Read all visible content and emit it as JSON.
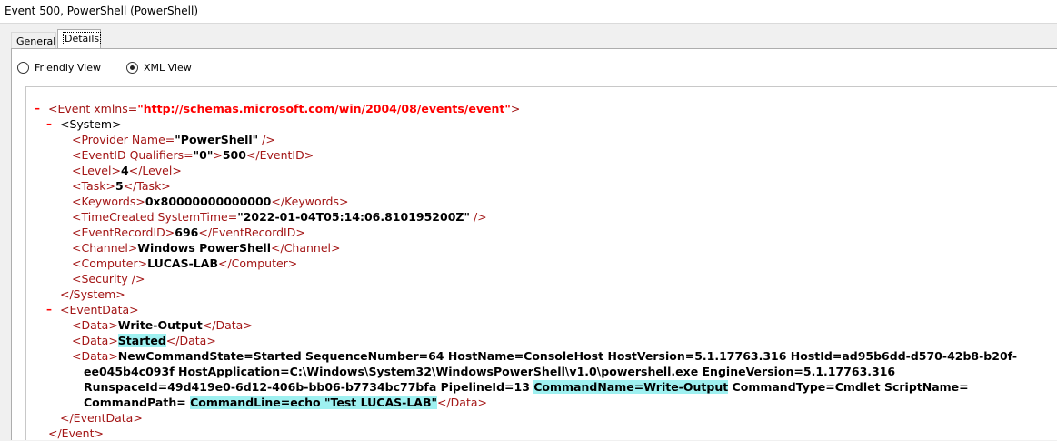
{
  "window": {
    "title": "Event 500, PowerShell (PowerShell)"
  },
  "tabs": [
    {
      "label": "General"
    },
    {
      "label": "Details"
    }
  ],
  "view_options": {
    "friendly": "Friendly View",
    "xml": "XML View",
    "selected": "XML View"
  },
  "xml": {
    "event_open": "<Event xmlns=",
    "xmlns_value": "\"http://schemas.microsoft.com/win/2004/08/events/event\"",
    "event_open_end": ">",
    "system_open": "<System>",
    "provider_tag": "<Provider Name=",
    "provider_value": "\"PowerShell\"",
    "provider_end": " />",
    "eventid_tag": "<EventID Qualifiers=",
    "eventid_qual": "\"0\"",
    "eventid_gt": ">",
    "eventid_value": "500",
    "eventid_close": "</EventID>",
    "level_tag": "<Level>",
    "level_value": "4",
    "level_close": "</Level>",
    "task_tag": "<Task>",
    "task_value": "5",
    "task_close": "</Task>",
    "keywords_tag": "<Keywords>",
    "keywords_value": "0x80000000000000",
    "keywords_close": "</Keywords>",
    "timecreated_tag": "<TimeCreated SystemTime=",
    "timecreated_value": "\"2022-01-04T05:14:06.810195200Z\"",
    "timecreated_end": " />",
    "recordid_tag": "<EventRecordID>",
    "recordid_value": "696",
    "recordid_close": "</EventRecordID>",
    "channel_tag": "<Channel>",
    "channel_value": "Windows PowerShell",
    "channel_close": "</Channel>",
    "computer_tag": "<Computer>",
    "computer_value": "LUCAS-LAB",
    "computer_close": "</Computer>",
    "security_tag": "<Security />",
    "system_close": "</System>",
    "eventdata_open": "<EventData>",
    "data_tag": "<Data>",
    "data_close": "</Data>",
    "data1_value": "Write-Output",
    "data2_value": "Started",
    "data3_line1": "NewCommandState=Started SequenceNumber=64 HostName=ConsoleHost HostVersion=5.1.17763.316 HostId=ad95b6dd-d570-42b8-b20f-",
    "data3_line2": "ee045b4c093f HostApplication=C:\\Windows\\System32\\WindowsPowerShell\\v1.0\\powershell.exe EngineVersion=5.1.17763.316",
    "data3_line3a": "RunspaceId=49d419e0-6d12-406b-bb06-b7734bc77bfa PipelineId=13 ",
    "data3_line3b": "CommandName=Write-Output",
    "data3_line3c": " CommandType=Cmdlet ScriptName=",
    "data3_line4a": "CommandPath= ",
    "data3_line4b": "CommandLine=echo \"Test LUCAS-LAB\"",
    "eventdata_close": "</EventData>",
    "event_close": "</Event>",
    "collapse_glyph": "–"
  }
}
